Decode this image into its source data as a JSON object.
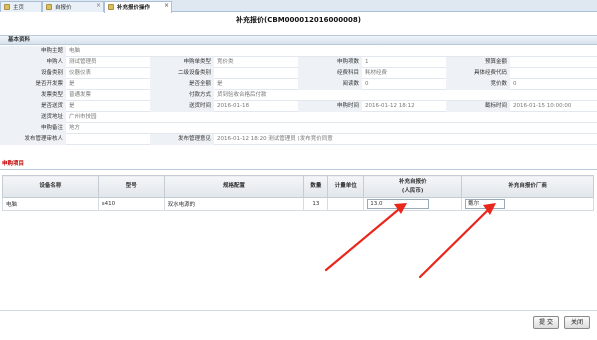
{
  "tabs": [
    {
      "label": "主页",
      "icon": "home-icon"
    },
    {
      "label": "自报价",
      "icon": "page-icon"
    },
    {
      "label": "补充报价操作",
      "icon": "page-icon",
      "active": true
    }
  ],
  "title": "补充报价(CBM000012016000008)",
  "section_basic": "基本资料",
  "section_items": "申购项目",
  "form": {
    "subject_label": "申购主题",
    "subject_value": "电脑",
    "applicant_label": "申购人",
    "applicant_value": "测试管理员",
    "order_type_label": "申购单类型",
    "order_type_value": "竞价类",
    "item_count_label": "申购项数",
    "item_count_value": "1",
    "budget_label": "预算金额",
    "budget_value": "",
    "category_label": "设备类别",
    "category_value": "仪器仪表",
    "subcategory_label": "二级设备类别",
    "subcategory_value": "",
    "account_label": "经费科目",
    "account_value": "耗材经费",
    "funding_code_label": "具体经费代码",
    "funding_code_value": "",
    "invoice_label": "是否开发票",
    "invoice_value": "是",
    "deposit_label": "是否全额",
    "deposit_value": "是",
    "read_count_label": "阅读数",
    "read_count_value": "0",
    "bid_count_label": "竞价数",
    "bid_count_value": "0",
    "invoice_type_label": "发票类型",
    "invoice_type_value": "普通发票",
    "payment_label": "付款方式",
    "payment_value": "货到验收合格后付款",
    "delivery_flag_label": "是否送货",
    "delivery_flag_value": "是",
    "delivery_time_label": "送货时间",
    "delivery_time_value": "2016-01-18",
    "apply_time_label": "申购时间",
    "apply_time_value": "2016-01-12 18:12",
    "deadline_label": "截标时间",
    "deadline_value": "2016-01-15 10:00:00",
    "address_label": "送货地址",
    "address_value": "广州市技园",
    "remark_label": "申购备注",
    "remark_value": "地方",
    "approver_label": "发布管理审核人",
    "approver_value": "",
    "approve_opinion_label": "发布管理意见",
    "approve_opinion_value": "2016-01-12 18:20 测试管理员 (发布竞价同意"
  },
  "table": {
    "headers": [
      "设备名称",
      "型号",
      "规格配置",
      "数量",
      "计量单位",
      "补充自报价\n(人民币)",
      "补充自报价厂商"
    ],
    "rows": [
      {
        "name": "电脑",
        "model": "s410",
        "spec": "双水电源的",
        "qty": "13",
        "unit": "",
        "price": "13.0",
        "vendor": "戴尔"
      }
    ]
  },
  "buttons": {
    "submit": "提 交",
    "close": "关闭"
  }
}
